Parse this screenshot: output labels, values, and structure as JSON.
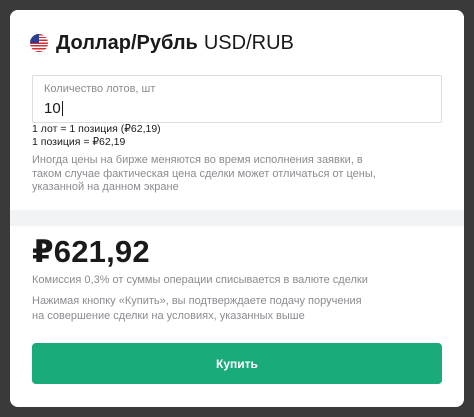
{
  "header": {
    "flag_icon": "us-flag-icon",
    "title": "Доллар/Рубль",
    "ticker": "USD/RUB"
  },
  "lots_input": {
    "label": "Количество лотов, шт",
    "value": "10"
  },
  "lot_info": {
    "line1": "1 лот = 1 позиция (₽62,19)",
    "line2": "1 позиция = ₽62,19"
  },
  "price_note": "Иногда цены на бирже меняются во время исполнения заявки, в таком случае фактическая цена сделки может отличаться от цены, указанной на данном экране",
  "total": {
    "amount": "₽621,92",
    "commission": "Комиссия 0,3% от суммы операции списывается в валюте сделки",
    "agreement": "Нажимая кнопку «Купить», вы подтверждаете подачу поручения на совершение сделки на условиях, указанных выше"
  },
  "buy_button": {
    "label": "Купить",
    "color": "#1aab7b"
  }
}
